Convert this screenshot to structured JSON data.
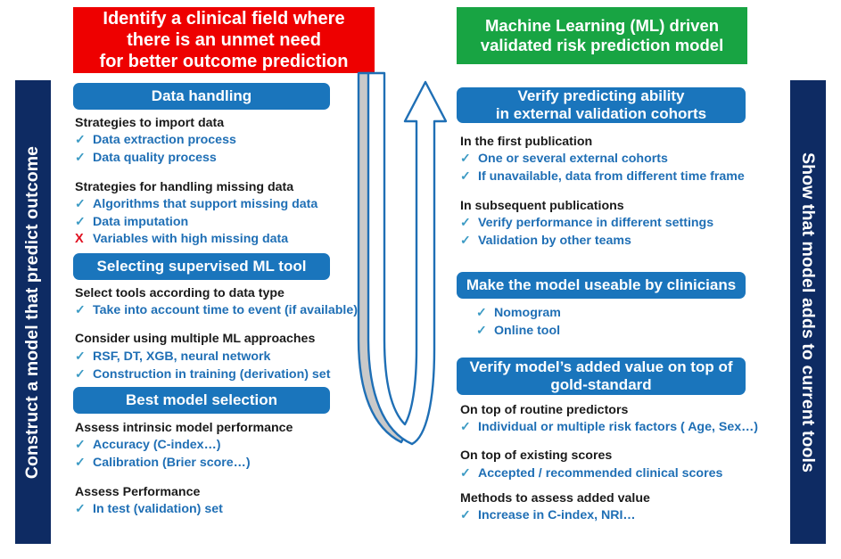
{
  "sidebars": {
    "left": {
      "label": "Construct a model that predict outcome"
    },
    "right": {
      "label": "Show that model adds to current tools"
    }
  },
  "banners": {
    "start": {
      "line1": "Identify a clinical field where",
      "line2": "there is an unmet need",
      "line3": "for better outcome prediction",
      "color": "#EE0000"
    },
    "end": {
      "line1": "Machine Learning (ML) driven",
      "line2": "validated risk prediction model",
      "color": "#18A443"
    }
  },
  "left_column": {
    "sections": [
      {
        "header": "Data handling",
        "groups": [
          {
            "title": "Strategies to import data",
            "items": [
              {
                "mark": "check",
                "text": "Data extraction process"
              },
              {
                "mark": "check",
                "text": "Data quality process"
              }
            ]
          },
          {
            "title": "Strategies for handling missing data",
            "items": [
              {
                "mark": "check",
                "text": "Algorithms that support missing data"
              },
              {
                "mark": "check",
                "text": "Data imputation"
              },
              {
                "mark": "cross",
                "text": "Variables with high missing data"
              }
            ]
          }
        ]
      },
      {
        "header": "Selecting supervised ML  tool",
        "groups": [
          {
            "title": "Select tools according to data type",
            "items": [
              {
                "mark": "check",
                "text": "Take into account time to event (if available)"
              }
            ]
          },
          {
            "title": "Consider using multiple ML approaches",
            "items": [
              {
                "mark": "check",
                "text": "RSF, DT, XGB, neural network"
              },
              {
                "mark": "check",
                "text": "Construction in training (derivation) set"
              }
            ]
          }
        ]
      },
      {
        "header": "Best model selection",
        "groups": [
          {
            "title": "Assess intrinsic model performance",
            "items": [
              {
                "mark": "check",
                "text": "Accuracy (C-index…)"
              },
              {
                "mark": "check",
                "text": "Calibration (Brier score…)"
              }
            ]
          },
          {
            "title": "Assess Performance",
            "items": [
              {
                "mark": "check",
                "text": "In test (validation) set"
              }
            ]
          }
        ]
      }
    ]
  },
  "right_column": {
    "sections": [
      {
        "header_line1": "Verify predicting ability",
        "header_line2": "in external validation cohorts",
        "groups": [
          {
            "title": "In the first publication",
            "items": [
              {
                "mark": "check",
                "text": "One or several external cohorts"
              },
              {
                "mark": "check",
                "text": "If unavailable, data from different time frame"
              }
            ]
          },
          {
            "title": "In subsequent publications",
            "items": [
              {
                "mark": "check",
                "text": "Verify performance in different settings"
              },
              {
                "mark": "check",
                "text": "Validation by other teams"
              }
            ]
          }
        ]
      },
      {
        "header_line1": "Make the model useable by clinicians",
        "header_line2": "",
        "groups": [
          {
            "title": "",
            "items": [
              {
                "mark": "check",
                "text": "Nomogram"
              },
              {
                "mark": "check",
                "text": "Online tool"
              }
            ]
          }
        ]
      },
      {
        "header_line1": "Verify model’s added value on top of",
        "header_line2": "gold-standard",
        "groups": [
          {
            "title": "On top of routine predictors",
            "items": [
              {
                "mark": "check",
                "text": "Individual or multiple risk factors ( Age, Sex…)"
              }
            ]
          },
          {
            "title": "On top of existing scores",
            "items": [
              {
                "mark": "check",
                "text": "Accepted / recommended clinical scores"
              }
            ]
          },
          {
            "title": "Methods to assess added value",
            "items": [
              {
                "mark": "check",
                "text": "Increase in C-index, NRI…"
              }
            ]
          }
        ]
      }
    ]
  },
  "flow_arrow": {
    "name": "u-shaped-process-arrow",
    "direction": "down-then-up",
    "stroke_color": "#1F6FB5",
    "fill_color": "#C9C9C9",
    "arrowhead": "up"
  },
  "glyphs": {
    "check": "✓",
    "cross": "X"
  },
  "palette": {
    "navy": "#0E2B63",
    "blue": "#1A75BC",
    "red": "#EE0000",
    "green": "#18A443",
    "text_blue": "#1F6FB5",
    "check_teal": "#3C9BC4",
    "cross_red": "#E01020"
  }
}
